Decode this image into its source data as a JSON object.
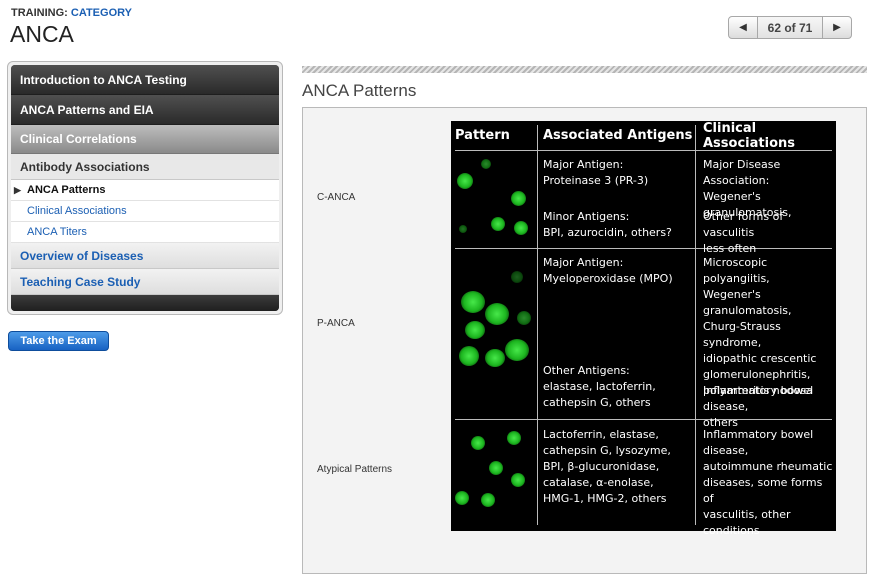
{
  "breadcrumb": {
    "prefix": "TRAINING:",
    "category": "CATEGORY"
  },
  "title": "ANCA",
  "pager": {
    "prev_icon": "triangle-left",
    "next_icon": "triangle-right",
    "text": "62 of 71"
  },
  "nav": {
    "items": [
      {
        "label": "Introduction to ANCA Testing"
      },
      {
        "label": "ANCA Patterns and EIA"
      },
      {
        "label": "Clinical Correlations"
      },
      {
        "label": "Antibody Associations"
      },
      {
        "label": "ANCA Patterns"
      },
      {
        "label": "Clinical Associations"
      },
      {
        "label": "ANCA Titers"
      },
      {
        "label": "Overview of Diseases"
      },
      {
        "label": "Teaching Case Study"
      }
    ]
  },
  "exam_button": "Take the Exam",
  "section_title": "ANCA Patterns",
  "row_labels": [
    "C-ANCA",
    "P-ANCA",
    "Atypical Patterns"
  ],
  "table": {
    "headers": [
      "Pattern",
      "Associated Antigens",
      "Clinical Associations"
    ],
    "rows": [
      {
        "antigens_a": "Major Antigen:\nProteinase 3 (PR-3)",
        "antigens_b": "Minor Antigens:\nBPI, azurocidin, others?",
        "clinical_a": "Major Disease Association:\nWegener's granulomatosis,",
        "clinical_b": "Other forms of vasculitis\nless often"
      },
      {
        "antigens_a": "Major Antigen:\nMyeloperoxidase (MPO)",
        "antigens_b": "Other Antigens:\nelastase, lactoferrin,\ncathepsin G, others",
        "clinical_a": "Microscopic polyangiitis,\nWegener's granulomatosis,\nChurg-Strauss syndrome,\nidiopathic crescentic\nglomerulonephritis,\npolyarteritis nodosa",
        "clinical_b": "Inflammatory bowel disease,\nothers"
      },
      {
        "antigens_a": "Lactoferrin, elastase,\ncathepsin G, lysozyme,\nBPI, β-glucuronidase,\ncatalase, α-enolase,\nHMG-1, HMG-2, others",
        "clinical_a": "Inflammatory bowel disease,\nautoimmune rheumatic\ndiseases, some forms of\nvasculitis, other conditions"
      }
    ]
  },
  "colors": {
    "link": "#1b5fb3",
    "fluorescence": "#2ee833",
    "exam_button": "#1862c3"
  }
}
